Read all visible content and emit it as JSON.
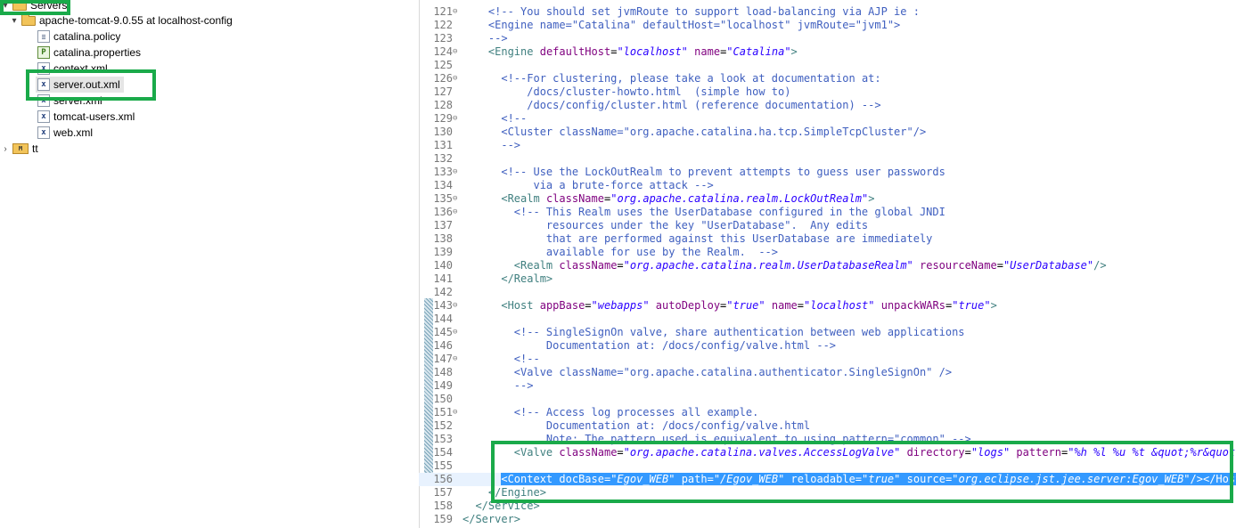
{
  "explorer": {
    "servers_label": "Servers",
    "server_label": "apache-tomcat-9.0.55 at localhost-config",
    "files": [
      {
        "name": "catalina.policy",
        "icon": "file-icon"
      },
      {
        "name": "catalina.properties",
        "icon": "properties-file-icon"
      },
      {
        "name": "context.xml",
        "icon": "xml-file-icon"
      },
      {
        "name": "server.out.xml",
        "icon": "xml-file-icon"
      },
      {
        "name": "server.xml",
        "icon": "xml-file-icon"
      },
      {
        "name": "tomcat-users.xml",
        "icon": "xml-file-icon"
      },
      {
        "name": "web.xml",
        "icon": "xml-file-icon"
      }
    ],
    "project_label": "tt"
  },
  "editor": {
    "lines": [
      {
        "n": "121",
        "fold": "⊖",
        "segs": [
          [
            "    ",
            ""
          ],
          [
            "<!-- You should set jvmRoute to support load-balancing via AJP ie :",
            "c"
          ]
        ]
      },
      {
        "n": "122",
        "fold": "",
        "segs": [
          [
            "    ",
            ""
          ],
          [
            "<Engine name=\"Catalina\" defaultHost=\"localhost\" jvmRoute=\"jvm1\">",
            "c"
          ]
        ]
      },
      {
        "n": "123",
        "fold": "",
        "segs": [
          [
            "    ",
            ""
          ],
          [
            "-->",
            "c"
          ]
        ]
      },
      {
        "n": "124",
        "fold": "⊖",
        "segs": [
          [
            "    ",
            ""
          ],
          [
            "<Engine",
            "t"
          ],
          [
            " ",
            ""
          ],
          [
            "defaultHost",
            "a"
          ],
          [
            "=",
            ""
          ],
          [
            "\"localhost\"",
            "v"
          ],
          [
            " ",
            ""
          ],
          [
            "name",
            "a"
          ],
          [
            "=",
            ""
          ],
          [
            "\"Catalina\"",
            "v"
          ],
          [
            ">",
            "t"
          ]
        ]
      },
      {
        "n": "125",
        "fold": "",
        "segs": []
      },
      {
        "n": "126",
        "fold": "⊖",
        "segs": [
          [
            "      ",
            ""
          ],
          [
            "<!--For clustering, please take a look at documentation at:",
            "c"
          ]
        ]
      },
      {
        "n": "127",
        "fold": "",
        "segs": [
          [
            "          ",
            ""
          ],
          [
            "/docs/cluster-howto.html  (simple how to)",
            "c"
          ]
        ]
      },
      {
        "n": "128",
        "fold": "",
        "segs": [
          [
            "          ",
            ""
          ],
          [
            "/docs/config/cluster.html (reference documentation) -->",
            "c"
          ]
        ]
      },
      {
        "n": "129",
        "fold": "⊖",
        "segs": [
          [
            "      ",
            ""
          ],
          [
            "<!--",
            "c"
          ]
        ]
      },
      {
        "n": "130",
        "fold": "",
        "segs": [
          [
            "      ",
            ""
          ],
          [
            "<Cluster className=\"org.apache.catalina.ha.tcp.SimpleTcpCluster\"/>",
            "c"
          ]
        ]
      },
      {
        "n": "131",
        "fold": "",
        "segs": [
          [
            "      ",
            ""
          ],
          [
            "-->",
            "c"
          ]
        ]
      },
      {
        "n": "132",
        "fold": "",
        "segs": []
      },
      {
        "n": "133",
        "fold": "⊖",
        "segs": [
          [
            "      ",
            ""
          ],
          [
            "<!-- Use the LockOutRealm to prevent attempts to guess user passwords",
            "c"
          ]
        ]
      },
      {
        "n": "134",
        "fold": "",
        "segs": [
          [
            "           ",
            ""
          ],
          [
            "via a brute-force attack -->",
            "c"
          ]
        ]
      },
      {
        "n": "135",
        "fold": "⊖",
        "segs": [
          [
            "      ",
            ""
          ],
          [
            "<Realm",
            "t"
          ],
          [
            " ",
            ""
          ],
          [
            "className",
            "a"
          ],
          [
            "=",
            ""
          ],
          [
            "\"org.apache.catalina.realm.LockOutRealm\"",
            "v"
          ],
          [
            ">",
            "t"
          ]
        ]
      },
      {
        "n": "136",
        "fold": "⊖",
        "segs": [
          [
            "        ",
            ""
          ],
          [
            "<!-- This Realm uses the UserDatabase configured in the global JNDI",
            "c"
          ]
        ]
      },
      {
        "n": "137",
        "fold": "",
        "segs": [
          [
            "             ",
            ""
          ],
          [
            "resources under the key \"UserDatabase\".  Any edits",
            "c"
          ]
        ]
      },
      {
        "n": "138",
        "fold": "",
        "segs": [
          [
            "             ",
            ""
          ],
          [
            "that are performed against this UserDatabase are immediately",
            "c"
          ]
        ]
      },
      {
        "n": "139",
        "fold": "",
        "segs": [
          [
            "             ",
            ""
          ],
          [
            "available for use by the Realm.  -->",
            "c"
          ]
        ]
      },
      {
        "n": "140",
        "fold": "",
        "segs": [
          [
            "        ",
            ""
          ],
          [
            "<Realm",
            "t"
          ],
          [
            " ",
            ""
          ],
          [
            "className",
            "a"
          ],
          [
            "=",
            ""
          ],
          [
            "\"org.apache.catalina.realm.UserDatabaseRealm\"",
            "v"
          ],
          [
            " ",
            ""
          ],
          [
            "resourceName",
            "a"
          ],
          [
            "=",
            ""
          ],
          [
            "\"UserDatabase\"",
            "v"
          ],
          [
            "/>",
            "t"
          ]
        ]
      },
      {
        "n": "141",
        "fold": "",
        "segs": [
          [
            "      ",
            ""
          ],
          [
            "</Realm>",
            "t"
          ]
        ]
      },
      {
        "n": "142",
        "fold": "",
        "segs": []
      },
      {
        "n": "143",
        "fold": "⊖",
        "segs": [
          [
            "      ",
            ""
          ],
          [
            "<Host",
            "t"
          ],
          [
            " ",
            ""
          ],
          [
            "appBase",
            "a"
          ],
          [
            "=",
            ""
          ],
          [
            "\"webapps\"",
            "v"
          ],
          [
            " ",
            ""
          ],
          [
            "autoDeploy",
            "a"
          ],
          [
            "=",
            ""
          ],
          [
            "\"true\"",
            "v"
          ],
          [
            " ",
            ""
          ],
          [
            "name",
            "a"
          ],
          [
            "=",
            ""
          ],
          [
            "\"localhost\"",
            "v"
          ],
          [
            " ",
            ""
          ],
          [
            "unpackWARs",
            "a"
          ],
          [
            "=",
            ""
          ],
          [
            "\"true\"",
            "v"
          ],
          [
            ">",
            "t"
          ]
        ]
      },
      {
        "n": "144",
        "fold": "",
        "segs": []
      },
      {
        "n": "145",
        "fold": "⊖",
        "segs": [
          [
            "        ",
            ""
          ],
          [
            "<!-- SingleSignOn valve, share authentication between web applications",
            "c"
          ]
        ]
      },
      {
        "n": "146",
        "fold": "",
        "segs": [
          [
            "             ",
            ""
          ],
          [
            "Documentation at: /docs/config/valve.html -->",
            "c"
          ]
        ]
      },
      {
        "n": "147",
        "fold": "⊖",
        "segs": [
          [
            "        ",
            ""
          ],
          [
            "<!--",
            "c"
          ]
        ]
      },
      {
        "n": "148",
        "fold": "",
        "segs": [
          [
            "        ",
            ""
          ],
          [
            "<Valve className=\"org.apache.catalina.authenticator.SingleSignOn\" />",
            "c"
          ]
        ]
      },
      {
        "n": "149",
        "fold": "",
        "segs": [
          [
            "        ",
            ""
          ],
          [
            "-->",
            "c"
          ]
        ]
      },
      {
        "n": "150",
        "fold": "",
        "segs": []
      },
      {
        "n": "151",
        "fold": "⊖",
        "segs": [
          [
            "        ",
            ""
          ],
          [
            "<!-- Access log processes all example.",
            "c"
          ]
        ]
      },
      {
        "n": "152",
        "fold": "",
        "segs": [
          [
            "             ",
            ""
          ],
          [
            "Documentation at: /docs/config/valve.html",
            "c"
          ]
        ]
      },
      {
        "n": "153",
        "fold": "",
        "segs": [
          [
            "             ",
            ""
          ],
          [
            "Note: The pattern used is equivalent to using pattern=\"common\" -->",
            "c"
          ]
        ]
      },
      {
        "n": "154",
        "fold": "",
        "segs": [
          [
            "        ",
            ""
          ],
          [
            "<Valve",
            "t"
          ],
          [
            " ",
            ""
          ],
          [
            "className",
            "a"
          ],
          [
            "=",
            ""
          ],
          [
            "\"org.apache.catalina.valves.AccessLogValve\"",
            "v"
          ],
          [
            " ",
            ""
          ],
          [
            "directory",
            "a"
          ],
          [
            "=",
            ""
          ],
          [
            "\"logs\"",
            "v"
          ],
          [
            " ",
            ""
          ],
          [
            "pattern",
            "a"
          ],
          [
            "=",
            ""
          ],
          [
            "\"%h %l %u %t &quot;%r&quot; %s",
            "v"
          ]
        ]
      },
      {
        "n": "155",
        "fold": "",
        "segs": []
      },
      {
        "n": "156",
        "fold": "",
        "segs": [
          [
            "      ",
            ""
          ],
          [
            "<Context",
            "t"
          ],
          [
            " ",
            ""
          ],
          [
            "docBase",
            "a"
          ],
          [
            "=",
            ""
          ],
          [
            "\"Egov_WEB\"",
            "v"
          ],
          [
            " ",
            ""
          ],
          [
            "path",
            "a"
          ],
          [
            "=",
            ""
          ],
          [
            "\"/Egov_WEB\"",
            "v"
          ],
          [
            " ",
            ""
          ],
          [
            "reloadable",
            "a"
          ],
          [
            "=",
            ""
          ],
          [
            "\"true\"",
            "v"
          ],
          [
            " ",
            ""
          ],
          [
            "source",
            "a"
          ],
          [
            "=",
            ""
          ],
          [
            "\"org.eclipse.jst.jee.server:Egov_WEB\"",
            "v"
          ],
          [
            "/></Host>",
            "t"
          ]
        ]
      },
      {
        "n": "157",
        "fold": "",
        "segs": [
          [
            "    ",
            ""
          ],
          [
            "</Engine>",
            "t"
          ]
        ]
      },
      {
        "n": "158",
        "fold": "",
        "segs": [
          [
            "  ",
            ""
          ],
          [
            "</Service>",
            "t"
          ]
        ]
      },
      {
        "n": "159",
        "fold": "",
        "segs": [
          [
            "",
            ""
          ],
          [
            "</Server>",
            "t"
          ]
        ]
      }
    ]
  }
}
